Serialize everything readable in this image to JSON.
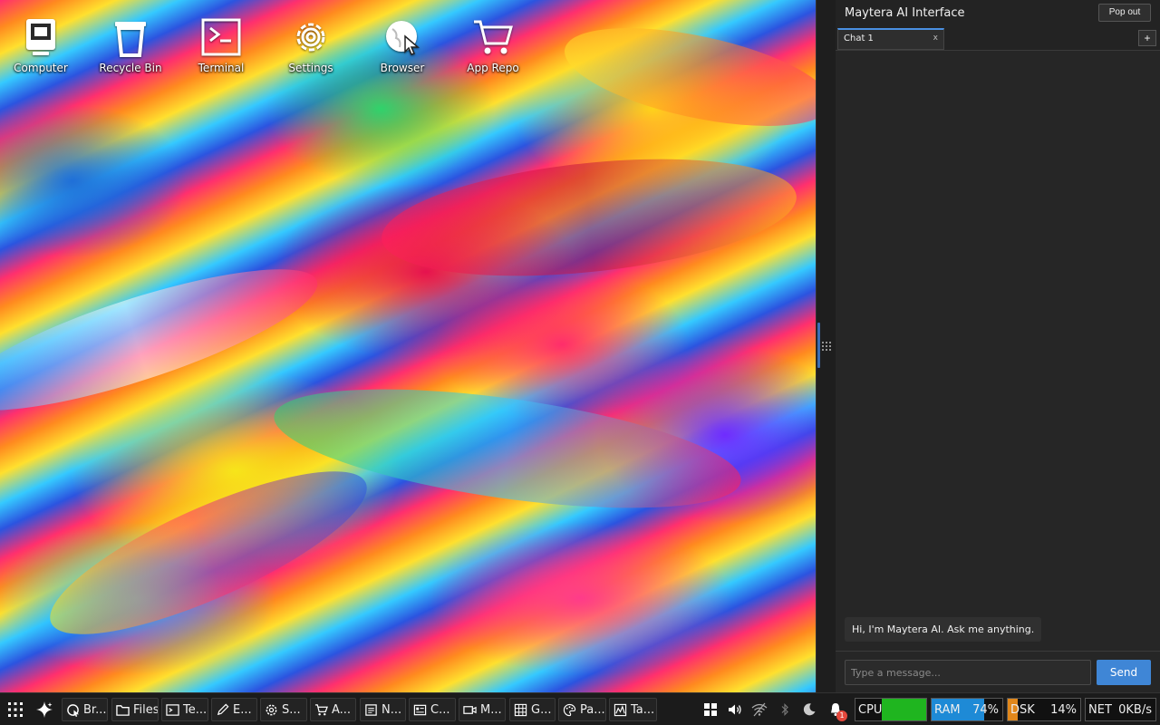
{
  "desktop": {
    "icons": [
      {
        "label": "Computer",
        "icon": "computer-icon"
      },
      {
        "label": "Recycle Bin",
        "icon": "recycle-bin-icon"
      },
      {
        "label": "Terminal",
        "icon": "terminal-icon"
      },
      {
        "label": "Settings",
        "icon": "gear-icon"
      },
      {
        "label": "Browser",
        "icon": "browser-icon"
      },
      {
        "label": "App Repo",
        "icon": "cart-icon"
      }
    ]
  },
  "ai_panel": {
    "title": "Maytera AI Interface",
    "popout_label": "Pop out",
    "tabs": [
      {
        "label": "Chat 1",
        "close": "x"
      }
    ],
    "add_tab_label": "+",
    "messages": [
      {
        "role": "assistant",
        "text": "Hi, I'm Maytera AI. Ask me anything."
      }
    ],
    "input_placeholder": "Type a message...",
    "send_label": "Send"
  },
  "taskbar": {
    "tasks": [
      {
        "label": "Br...",
        "icon": "browser-icon"
      },
      {
        "label": "Files",
        "icon": "folder-icon"
      },
      {
        "label": "Te...",
        "icon": "terminal-icon"
      },
      {
        "label": "E...",
        "icon": "pencil-icon"
      },
      {
        "label": "S...",
        "icon": "gear-icon"
      },
      {
        "label": "A...",
        "icon": "cart-icon"
      },
      {
        "label": "N...",
        "icon": "notes-icon"
      },
      {
        "label": "C...",
        "icon": "contacts-icon"
      },
      {
        "label": "M...",
        "icon": "video-icon"
      },
      {
        "label": "G...",
        "icon": "grid-icon"
      },
      {
        "label": "Pa...",
        "icon": "palette-icon"
      },
      {
        "label": "Ta...",
        "icon": "chart-icon"
      }
    ],
    "notification_count": "1",
    "meters": {
      "cpu": {
        "label": "CPU",
        "value": "",
        "fraction": 1.0,
        "color": "#1fb51f"
      },
      "ram": {
        "label": "RAM",
        "value": "74%",
        "fraction": 0.74,
        "color": "#1e8ad6"
      },
      "dsk": {
        "label": "DSK",
        "value": "14%",
        "fraction": 0.14,
        "color": "#e0871b"
      },
      "net": {
        "label": "NET",
        "value": "0KB/s"
      }
    }
  }
}
